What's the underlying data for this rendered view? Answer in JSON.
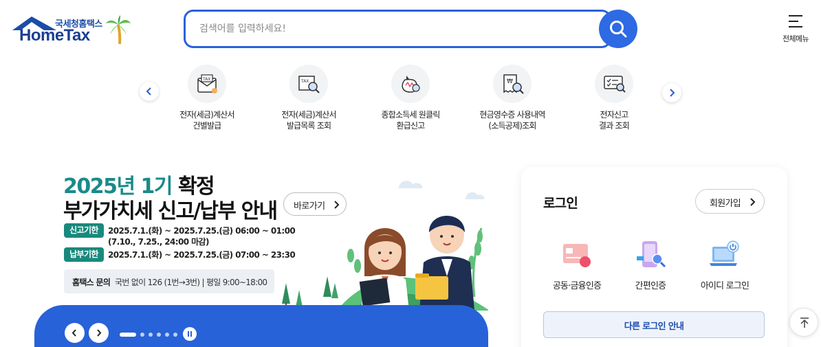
{
  "header": {
    "logo_org": "국세청홈택스",
    "logo_brand": "HomeTax",
    "search_placeholder": "검색어를 입력하세요!",
    "search_value": "",
    "menu_label": "전체메뉴"
  },
  "quick_services": [
    {
      "line1": "전자(세금)계산서",
      "line2": "건별발급",
      "icon": "tax-invoice-envelope-icon"
    },
    {
      "line1": "전자(세금)계산서",
      "line2": "발급목록 조회",
      "icon": "tax-invoice-search-icon"
    },
    {
      "line1": "종합소득세 원클릭",
      "line2": "환급신고",
      "icon": "refund-money-bag-icon"
    },
    {
      "line1": "현금영수증 사용내역",
      "line2": "(소득공제)조회",
      "icon": "cash-receipt-search-icon"
    },
    {
      "line1": "전자신고",
      "line2": "결과 조회",
      "icon": "e-filing-result-icon"
    }
  ],
  "banner": {
    "title_colored": "2025년 1기",
    "title_dark": " 확정",
    "title_line2": "부가가치세 신고/납부 안내",
    "go_label": "바로가기",
    "filing_pill": "신고기한",
    "filing_period": "2025.7.1.(화) ~ 2025.7.25.(금) 06:00 ~ 01:00",
    "filing_note": "(7.10., 7.25., 24:00 마감)",
    "payment_pill": "납부기한",
    "payment_period": "2025.7.1.(화) ~ 2025.7.25.(금) 07:00 ~ 23:30",
    "inquiry_label": "홈택스 문의",
    "inquiry_value": "국번 없이 126 (1번→3번)  |  평일 9:00~18:00",
    "slide_count": 6,
    "active_slide": 1
  },
  "login": {
    "title": "로그인",
    "signup_label": "회원가입",
    "options": [
      {
        "label": "공동·금융인증",
        "icon": "certificate-card-icon"
      },
      {
        "label": "간편인증",
        "icon": "simple-auth-phone-icon"
      },
      {
        "label": "아이디 로그인",
        "icon": "id-login-laptop-icon"
      }
    ],
    "other_label": "다른 로그인 안내"
  },
  "colors": {
    "primary": "#2d6ae3",
    "banner_bar": "#2762d8",
    "banner_teal": "#1b8a8a",
    "pill_green": "#19897d"
  }
}
